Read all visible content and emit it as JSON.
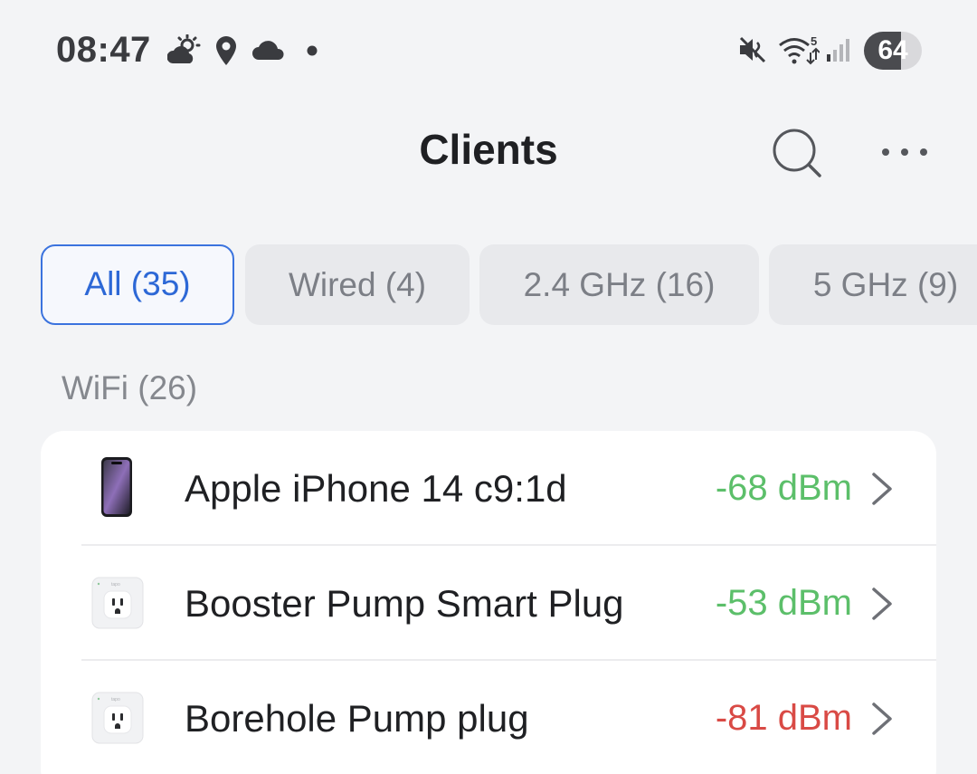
{
  "status_bar": {
    "time": "08:47",
    "left_icons": [
      "weather-partly-cloudy-icon",
      "location-pin-icon",
      "cloud-icon",
      "notification-dot-icon"
    ],
    "right_icons": [
      "vibrate-mute-icon",
      "wifi-5ghz-icon",
      "cell-signal-icon"
    ],
    "battery_level": "64",
    "battery_fraction": 0.64
  },
  "header": {
    "title": "Clients",
    "search_icon": "search-icon",
    "more_icon": "more-dots-icon"
  },
  "filters": [
    {
      "label": "All (35)",
      "active": true
    },
    {
      "label": "Wired (4)",
      "active": false
    },
    {
      "label": "2.4 GHz (16)",
      "active": false
    },
    {
      "label": "5 GHz (9)",
      "active": false
    }
  ],
  "section": {
    "title": "WiFi (26)"
  },
  "clients": [
    {
      "name": "Apple iPhone 14 c9:1d",
      "signal": "-68 dBm",
      "signal_status": "good",
      "icon": "iphone-icon"
    },
    {
      "name": "Booster Pump Smart Plug",
      "signal": "-53 dBm",
      "signal_status": "good",
      "icon": "smart-plug-icon"
    },
    {
      "name": "Borehole Pump plug",
      "signal": "-81 dBm",
      "signal_status": "weak",
      "icon": "smart-plug-icon"
    }
  ],
  "colors": {
    "accent": "#3b73de",
    "signal_good": "#5cbf6a",
    "signal_weak": "#d94a45",
    "background": "#f3f4f6"
  }
}
